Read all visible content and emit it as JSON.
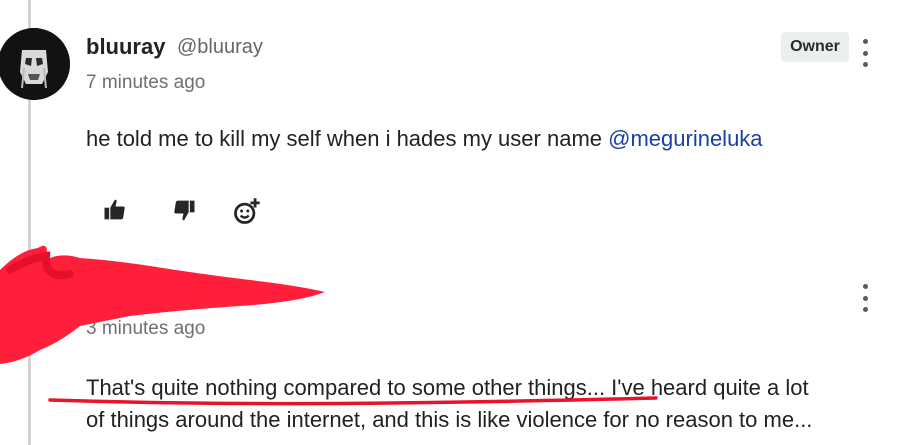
{
  "comment": {
    "author": "bluuray",
    "handle": "@bluuray",
    "timestamp": "7 minutes ago",
    "badge": "Owner",
    "text": "he told me to kill my self when i hades my user name ",
    "mention": "@megurineluka",
    "actions": {
      "like_icon": "thumbs-up-icon",
      "dislike_icon": "thumbs-down-icon",
      "react_icon": "add-emoji-icon"
    }
  },
  "reply": {
    "timestamp": "3 minutes ago",
    "lines": [
      "That's quite nothing compared to some other things... I've heard quite a lot",
      "of things around the internet, and this is like violence for no reason to me..."
    ],
    "redaction_color": "#ff1f3a",
    "underline_color": "#e8142c"
  },
  "colors": {
    "mention": "#1a3fa8",
    "badge_bg": "#e8efec"
  }
}
